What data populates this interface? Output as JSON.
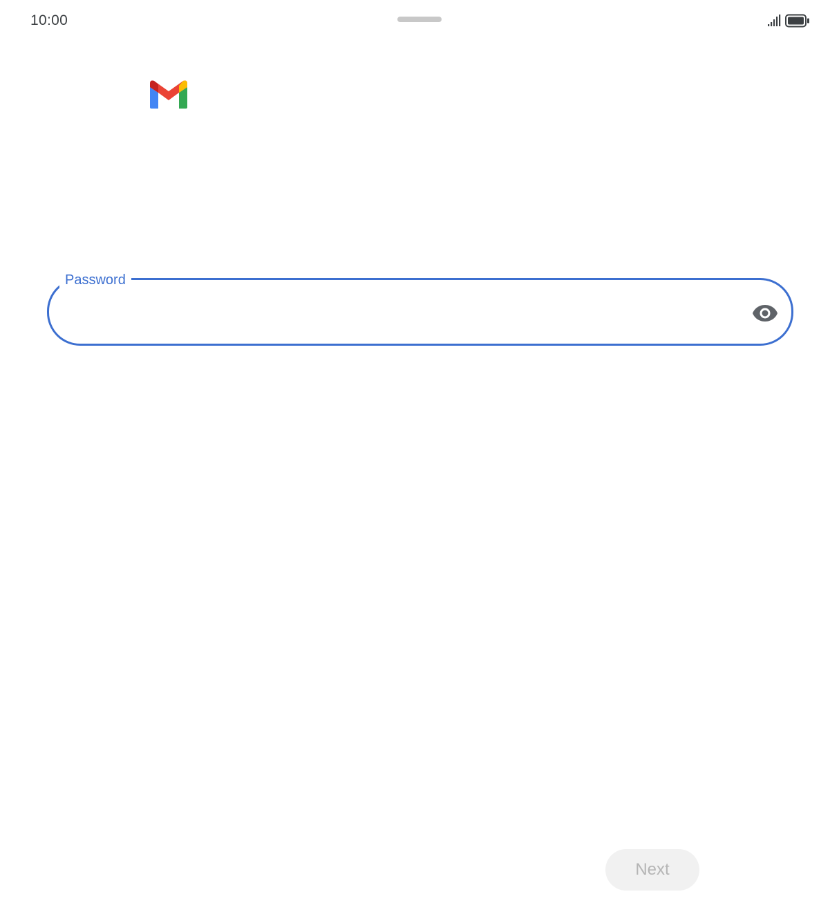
{
  "status_bar": {
    "time": "10:00",
    "signal_icon": "signal-icon",
    "battery_icon": "battery-icon"
  },
  "logo": {
    "icon": "gmail-logo-icon",
    "colors": {
      "blue": "#4285F4",
      "red": "#EA4335",
      "yellow": "#FBBC04",
      "green": "#34A853",
      "dark_red": "#C5221F"
    }
  },
  "password_field": {
    "label": "Password",
    "value": "",
    "placeholder": "",
    "accent_color": "#3C6FD0",
    "toggle_icon": "eye-icon"
  },
  "actions": {
    "next_label": "Next",
    "next_enabled": false
  }
}
